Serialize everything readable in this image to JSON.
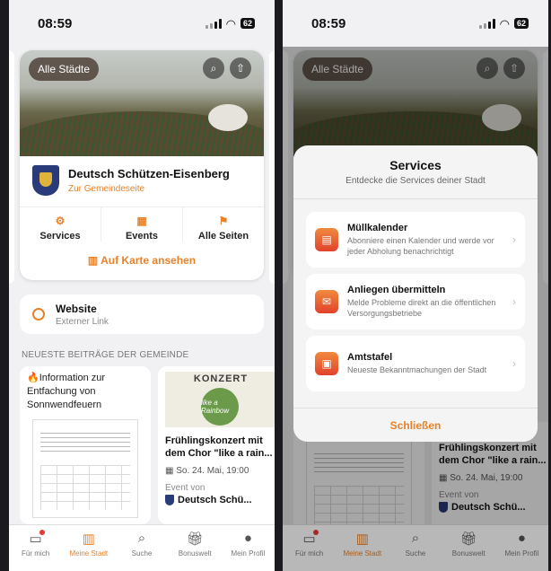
{
  "status": {
    "time": "08:59",
    "battery": "62"
  },
  "city": {
    "chip": "Alle Städte",
    "name": "Deutsch Schützen-Eisenberg",
    "link": "Zur Gemeindeseite",
    "actions": [
      "Services",
      "Events",
      "Alle Seiten"
    ],
    "map_link": "Auf Karte ansehen"
  },
  "website": {
    "title": "Website",
    "subtitle": "Externer Link"
  },
  "section_title": "NEUESTE BEITRÄGE DER GEMEINDE",
  "posts": {
    "p1": {
      "title": "Information zur Entfachung von Sonnwendfeuern"
    },
    "p2": {
      "poster_header": "KONZERT",
      "poster_badge": "like a Rainbow",
      "title": "Frühlingskonzert mit dem Chor \"like a rain...",
      "date": "So. 24. Mai, 19:00",
      "event_label": "Event von",
      "by": "Deutsch Schü..."
    }
  },
  "tabs": [
    "Für mich",
    "Meine Stadt",
    "Suche",
    "Bonuswelt",
    "Mein Profil"
  ],
  "services": {
    "title": "Services",
    "subtitle": "Entdecke die Services deiner Stadt",
    "items": [
      {
        "title": "Müllkalender",
        "desc": "Abonniere einen Kalender und werde vor jeder Abholung benachrichtigt"
      },
      {
        "title": "Anliegen übermitteln",
        "desc": "Melde Probleme direkt an die öffentlichen Versorgungsbetriebe"
      },
      {
        "title": "Amtstafel",
        "desc": "Neueste Bekanntmachungen der Stadt"
      }
    ],
    "close": "Schließen"
  },
  "colors": {
    "accent": "#e8822a",
    "crest": "#2a3b7a"
  }
}
